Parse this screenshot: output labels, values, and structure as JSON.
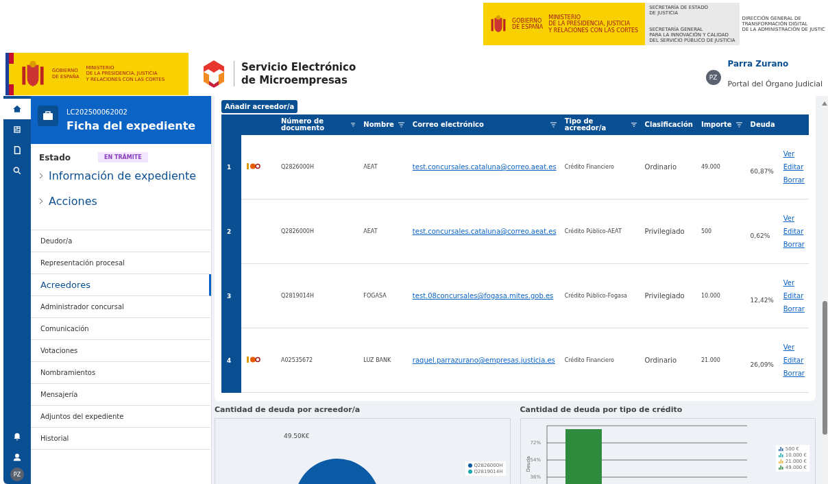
{
  "top_banner": {
    "gov_lines": [
      "GOBIERNO",
      "DE ESPAÑA"
    ],
    "ministry_lines": [
      "MINISTERIO",
      "DE LA PRESIDENCIA, JUSTICIA",
      "Y RELACIONES CON LAS CORTES"
    ],
    "secretaria_lines": [
      "SECRETARÍA DE ESTADO",
      "DE JUSTICIA"
    ],
    "secretaria_general_lines": [
      "SECRETARÍA GENERAL",
      "PARA LA INNOVACIÓN Y CALIDAD",
      "DEL SERVICIO PÚBLICO DE JUSTICIA"
    ],
    "direccion_lines": [
      "DIRECCIÓN GENERAL DE",
      "TRANSFORMACIÓN DIGITAL",
      "DE LA ADMINISTRACIÓN DE JUSTIC"
    ]
  },
  "header": {
    "gov_lines": [
      "GOBIERNO",
      "DE ESPAÑA"
    ],
    "ministry_lines": [
      "MINISTERIO",
      "DE LA PRESIDENCIA, JUSTICIA",
      "Y RELACIONES CON LAS CORTES"
    ],
    "app_title_lines": [
      "Servicio Electrónico",
      "de Microempresas"
    ],
    "user": {
      "initials": "PZ",
      "name": "Parra Zurano",
      "portal": "Portal del Órgano Judicial"
    }
  },
  "rail": {
    "items": [
      {
        "selected": true
      },
      {
        "selected": false
      },
      {
        "selected": false
      },
      {
        "selected": false
      }
    ],
    "avatar": "PZ"
  },
  "file_card": {
    "code": "LC202500062002",
    "title": "Ficha del expediente",
    "estado_label": "Estado",
    "estado_badge": "EN TRÁMITE",
    "sections": [
      {
        "label": "Información de expediente",
        "expanded": false
      },
      {
        "label": "Acciones",
        "expanded": false
      }
    ]
  },
  "nav": [
    {
      "label": "Deudor/a",
      "selected": false
    },
    {
      "label": "Representación procesal",
      "selected": false
    },
    {
      "label": "Acreedores",
      "selected": true
    },
    {
      "label": "Administrador concursal",
      "selected": false
    },
    {
      "label": "Comunicación",
      "selected": false
    },
    {
      "label": "Votaciones",
      "selected": false
    },
    {
      "label": "Nombramientos",
      "selected": false
    },
    {
      "label": "Mensajería",
      "selected": false
    },
    {
      "label": "Adjuntos del expediente",
      "selected": false
    },
    {
      "label": "Historial",
      "selected": false
    }
  ],
  "add_button": "Añadir acreedor/a",
  "table": {
    "columns": [
      {
        "label": "Número de documento",
        "filter": true
      },
      {
        "label": "Nombre",
        "filter": true
      },
      {
        "label": "Correo electrónico",
        "filter": true
      },
      {
        "label": "Tipo de acreedor/a",
        "filter": true
      },
      {
        "label": "Clasificación",
        "filter": false
      },
      {
        "label": "Importe",
        "filter": true
      },
      {
        "label": "Deuda",
        "filter": false
      }
    ],
    "rows": [
      {
        "index": "1",
        "has_logo": true,
        "documento": "Q2826000H",
        "nombre": "AEAT",
        "correo": "test.concursales.cataluna@correo.aeat.es",
        "tipo": "Crédito Financiero",
        "clasificacion": "Ordinario",
        "importe": "49.000",
        "deuda": "60,87%",
        "actions": [
          "Ver",
          "Editar",
          "Borrar"
        ]
      },
      {
        "index": "2",
        "has_logo": false,
        "documento": "Q2826000H",
        "nombre": "AEAT",
        "correo": "test.concursales.cataluna@correo.aeat.es",
        "tipo": "Crédito Público-AEAT",
        "clasificacion": "Privilegiado",
        "importe": "500",
        "deuda": "0,62%",
        "actions": [
          "Ver",
          "Editar",
          "Borrar"
        ]
      },
      {
        "index": "3",
        "has_logo": false,
        "documento": "Q2819014H",
        "nombre": "FOGASA",
        "correo": "test.08concursales@fogasa.mites.gob.es",
        "tipo": "Crédito Público-Fogasa",
        "clasificacion": "Privilegiado",
        "importe": "10.000",
        "deuda": "12,42%",
        "actions": [
          "Ver",
          "Editar",
          "Borrar"
        ]
      },
      {
        "index": "4",
        "has_logo": true,
        "documento": "A02535672",
        "nombre": "LUZ BANK",
        "correo": "raquel.parrazurano@empresas.justicia.es",
        "tipo": "Crédito Financiero",
        "clasificacion": "Ordinario",
        "importe": "21.000",
        "deuda": "26,09%",
        "actions": [
          "Ver",
          "Editar",
          "Borrar"
        ]
      }
    ]
  },
  "pie_chart": {
    "title": "Cantidad de deuda por acreedor/a",
    "slice_label": "49.50K€",
    "legend": [
      {
        "label": "Q2826000H",
        "color": "#0b5aa6"
      },
      {
        "label": "Q2819014H",
        "color": "#1ba9b0"
      }
    ]
  },
  "bar_chart": {
    "title": "Cantidad de deuda por tipo de crédito",
    "ylabel": "Deuda",
    "ytick_labels": [
      "72%",
      "54%",
      "36%"
    ],
    "legend": [
      {
        "label": "500 €",
        "color": "#1f5fa8"
      },
      {
        "label": "10.000 €",
        "color": "#1ba9b0"
      },
      {
        "label": "21.000 €",
        "color": "#f0b43a"
      },
      {
        "label": "49.000 €",
        "color": "#2e8b3e"
      }
    ]
  }
}
